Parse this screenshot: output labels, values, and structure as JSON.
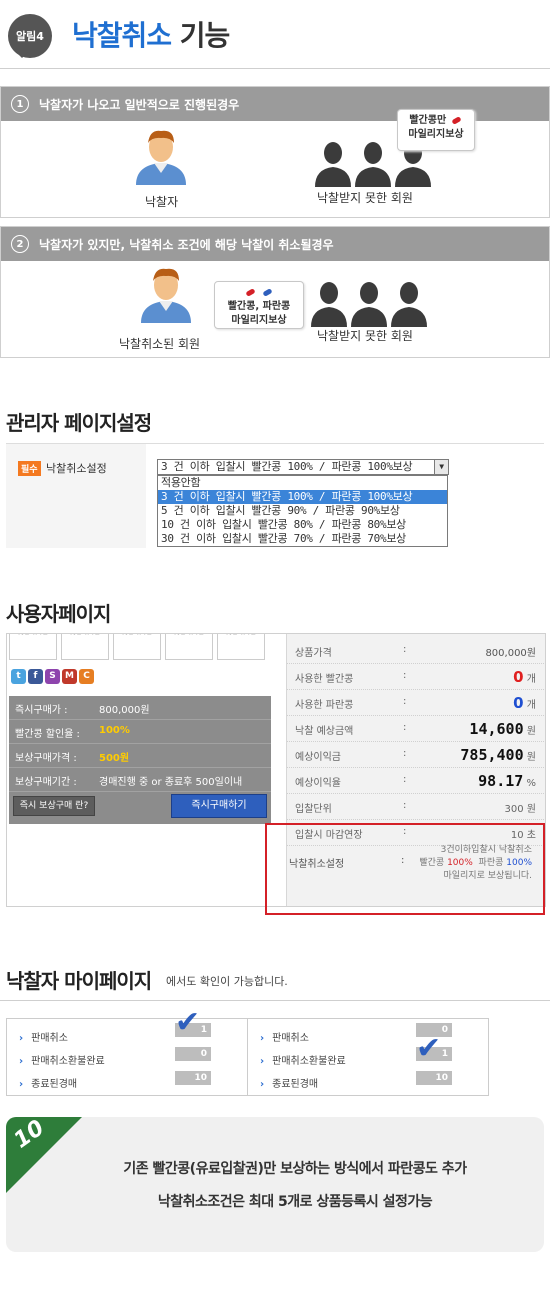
{
  "header": {
    "badge": "알림4",
    "title_highlight": "낙찰취소",
    "title_rest": " 기능"
  },
  "scenario1": {
    "num": "1",
    "title": "낙찰자가 나오고 일반적으로 진행된경우",
    "winner_caption": "낙찰자",
    "others_caption": "낙찰받지 못한 회원",
    "bubble_line1": "빨간콩만",
    "bubble_line2": "마일리지보상"
  },
  "scenario2": {
    "num": "2",
    "title": "낙찰자가 있지만, 낙찰취소 조건에 해당 낙찰이 취소될경우",
    "cancelled_caption": "낙찰취소된 회원",
    "others_caption": "낙찰받지 못한 회원",
    "bubble_line1": "빨간콩, 파란콩",
    "bubble_line2": "마일리지보상"
  },
  "admin": {
    "title": "관리자 페이지설정",
    "required_tag": "필수",
    "label": "낙찰취소설정",
    "selected": "3 건 이하 입찰시 빨간콩 100% / 파란콩 100%보상",
    "options": [
      "적용안함",
      "3 건 이하 입찰시 빨간콩 100% / 파란콩 100%보상",
      "5 건 이하 입찰시 빨간콩 90% / 파란콩 90%보상",
      "10 건 이하 입찰시 빨간콩 80% / 파란콩 80%보상",
      "30 건 이하 입찰시 빨간콩 70% / 파란콩 70%보상"
    ],
    "highlighted_index": 1
  },
  "user": {
    "title": "사용자페이지",
    "noimg": "NO IMG",
    "sns": [
      "t",
      "f",
      "S",
      "M",
      "C"
    ],
    "left_rows": [
      {
        "k": "즉시구매가 :",
        "v": "800,000원"
      },
      {
        "k": "빨간콩 할인율 :",
        "v": "100%"
      },
      {
        "k": "보상구매가격 :",
        "v": "500원"
      },
      {
        "k": "보상구매기간 :",
        "v": "경매진행 중 or 종료후 500일이내"
      }
    ],
    "btn_info": "즉시 보상구매 란?",
    "btn_buy": "즉시구매하기",
    "right_rows": [
      {
        "k": "상품가격",
        "v": "800,000원"
      },
      {
        "k": "사용한 빨간콩",
        "num": "0",
        "unit": "개"
      },
      {
        "k": "사용한 파란콩",
        "num": "0",
        "unit": "개"
      },
      {
        "k": "낙찰 예상금액",
        "num": "14,600",
        "unit": "원"
      },
      {
        "k": "예상이익금",
        "num": "785,400",
        "unit": "원"
      },
      {
        "k": "예상이익율",
        "num": "98.17",
        "unit": "%"
      },
      {
        "k": "입찰단위",
        "v": "300 원"
      },
      {
        "k": "입찰시 마감연장",
        "v": "10 초"
      }
    ],
    "colon": ":",
    "cancel_label": "낙찰취소설정",
    "cancel_line1": "3건이하입찰시 낙찰취소",
    "cancel_red_label": "빨간콩",
    "cancel_red_pct": "100%",
    "cancel_blue_label": "파란콩",
    "cancel_blue_pct": "100%",
    "cancel_line3": "마일리지로 보상됩니다."
  },
  "mypage": {
    "title": "낙찰자 마이페이지",
    "subtitle": "에서도 확인이 가능합니다.",
    "box1": [
      {
        "label": "판매취소",
        "count": "1"
      },
      {
        "label": "판매취소환불완료",
        "count": "0"
      },
      {
        "label": "종료된경매",
        "count": "10"
      }
    ],
    "box2": [
      {
        "label": "판매취소",
        "count": "0"
      },
      {
        "label": "판매취소환불완료",
        "count": "1"
      },
      {
        "label": "종료된경매",
        "count": "10"
      }
    ]
  },
  "note": {
    "ribbon_num": "10",
    "line1": "기존 빨간콩(유료입찰권)만 보상하는 방식에서 파란콩도 추가",
    "line2": "낙찰취소조건은 최대 5개로 상품등록시 설정가능"
  },
  "colors": {
    "accent_blue": "#1f6fd1",
    "red": "#d42027",
    "bar_gray": "#9b9b9b",
    "ribbon_green": "#2e7d3a"
  }
}
